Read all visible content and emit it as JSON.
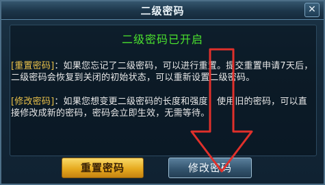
{
  "dialog": {
    "title": "二级密码",
    "close_glyph": "✕",
    "headline": "二级密码已开启",
    "reset_tag": "[重置密码]",
    "reset_text": "：如果您忘记了二级密码，可以进行重置。提交重置申请7天后，二级密码会恢复到关闭的初始状态，可以重新设置二级密码。",
    "modify_tag": "[修改密码]",
    "modify_text": "：如果您想变更二级密码的长度和强度，使用旧的密码，可以直接修改成新的密码，密码会立即生效，无需等待。",
    "buttons": {
      "reset_label": "重置密码",
      "modify_label": "修改密码"
    }
  },
  "colors": {
    "headline": "#4be22e",
    "tag": "#e8c04a",
    "arrow": "#e0302b"
  }
}
